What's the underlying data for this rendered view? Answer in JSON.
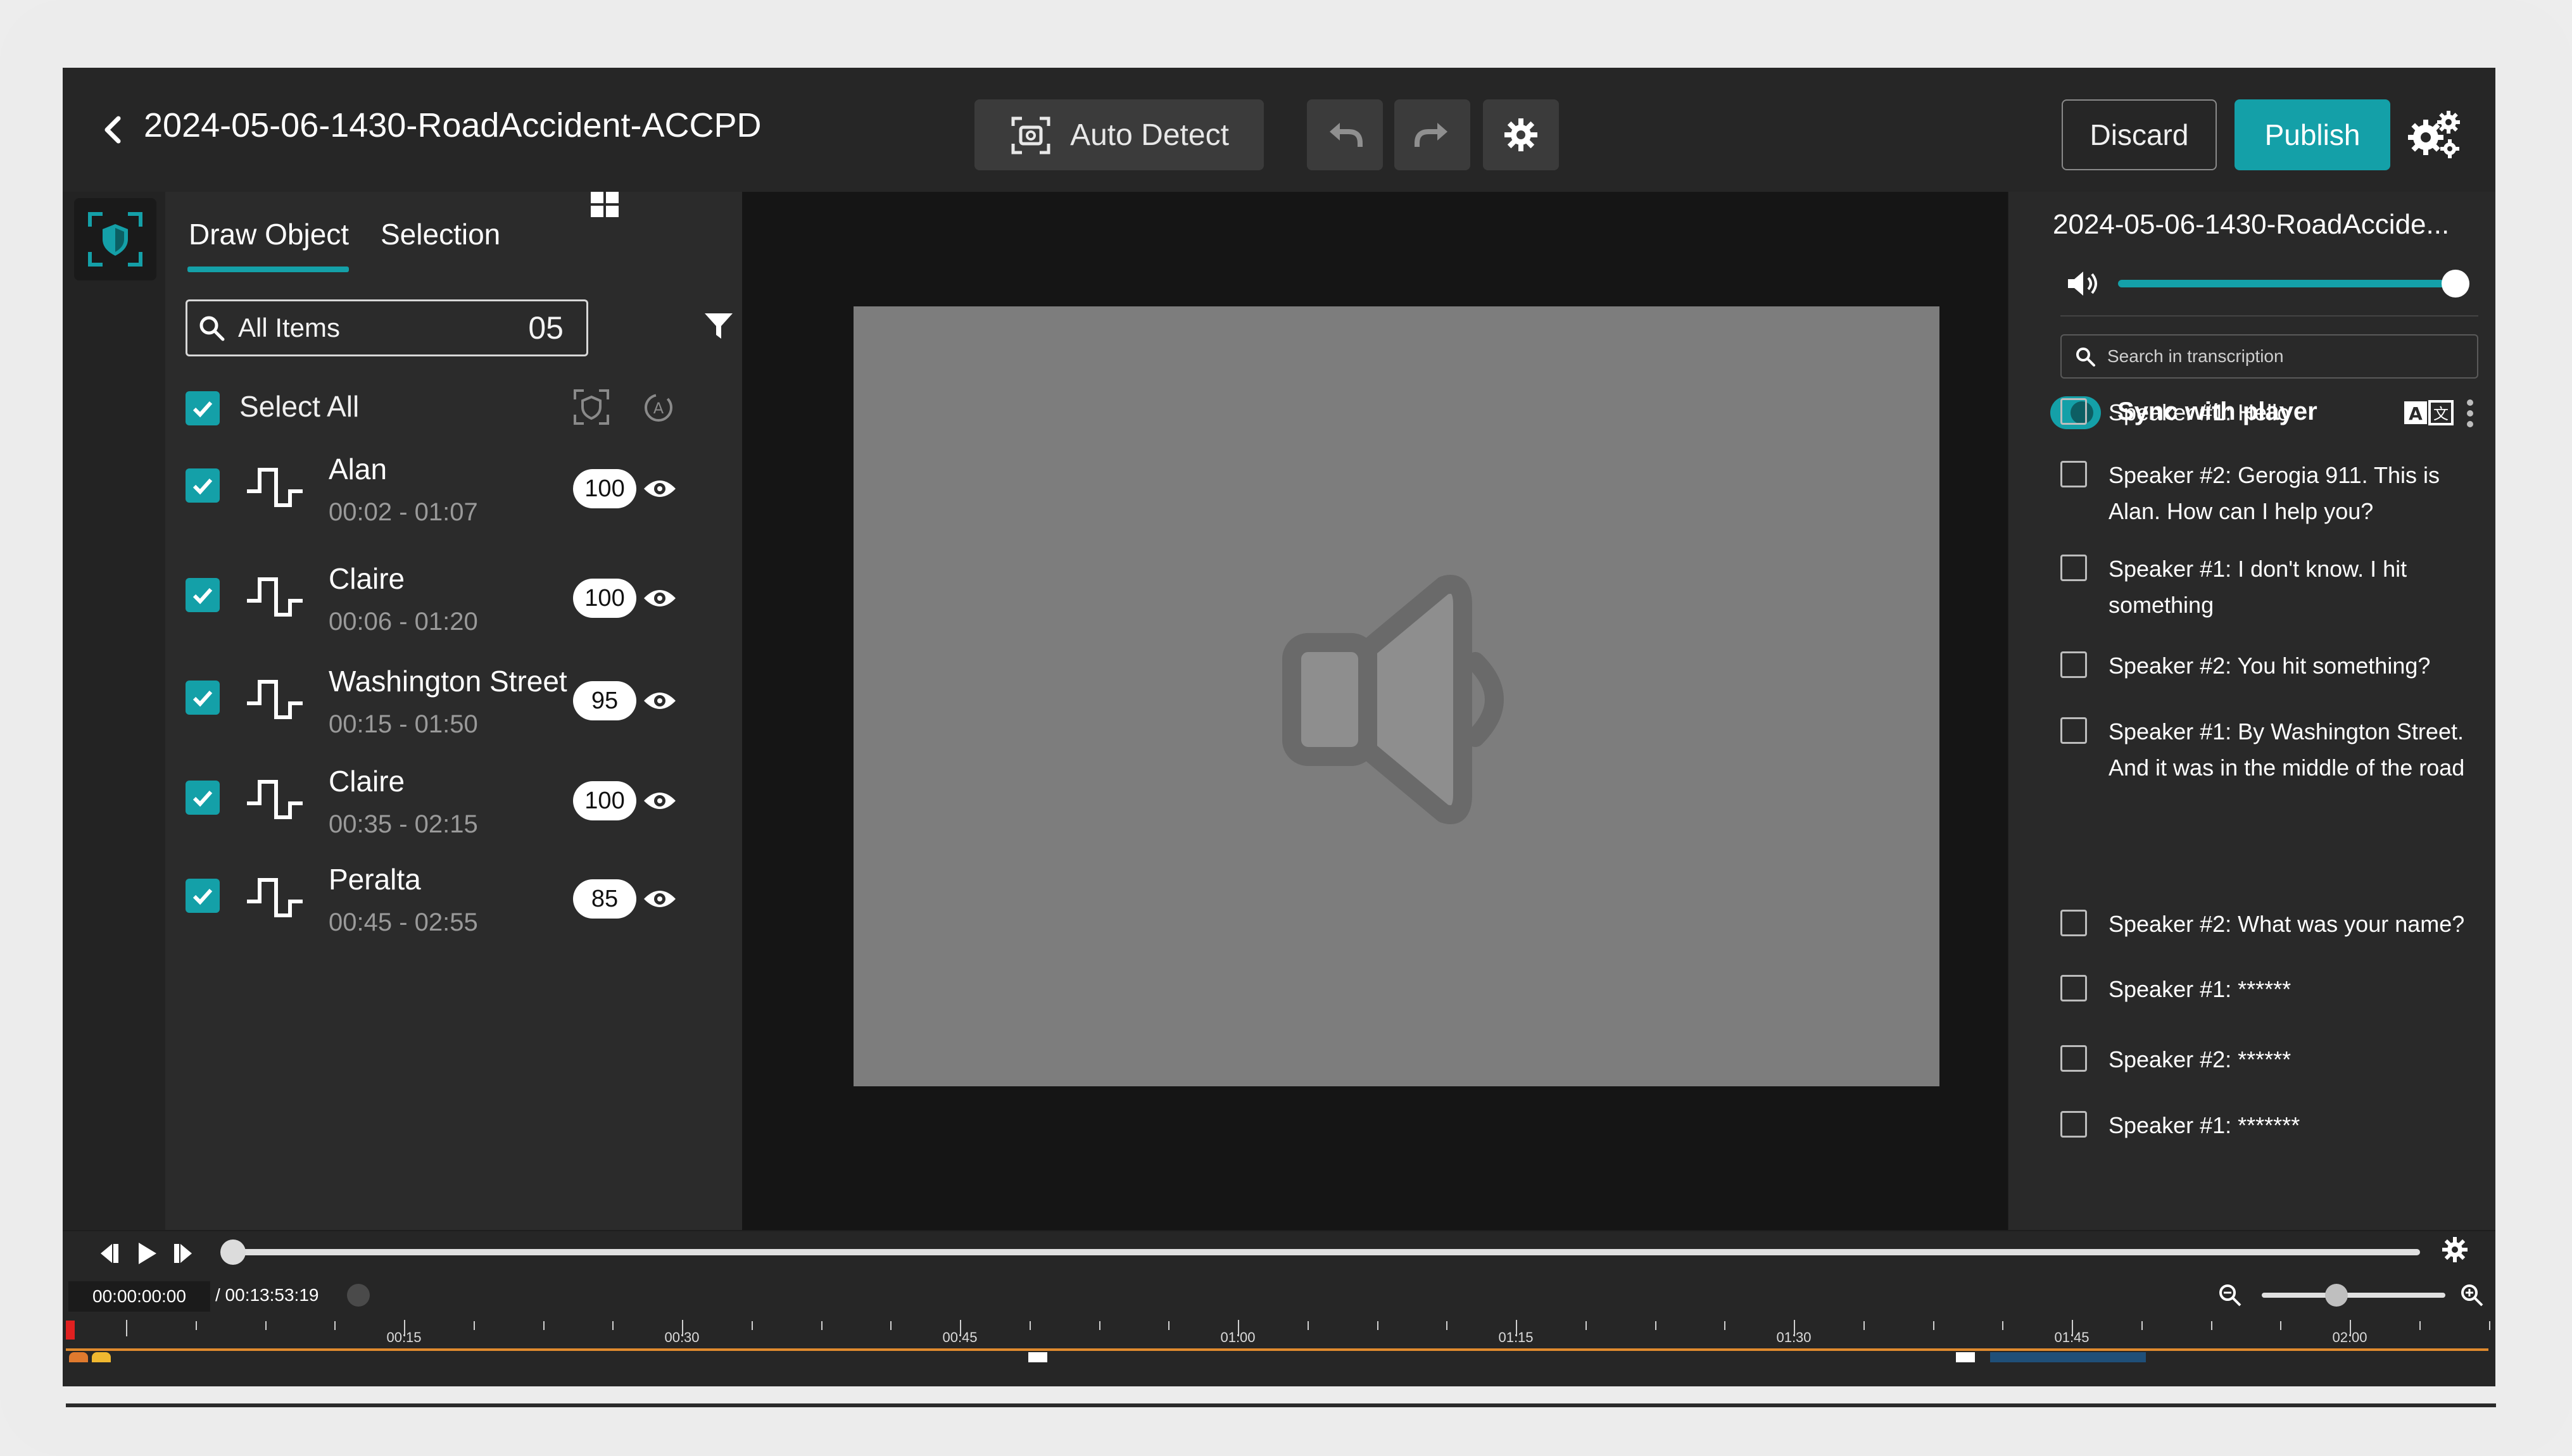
{
  "app": {
    "title": "2024-05-06-1430-RoadAccident-ACCPD"
  },
  "toolbar": {
    "auto_detect_label": "Auto Detect",
    "discard_label": "Discard",
    "publish_label": "Publish"
  },
  "left_panel": {
    "tabs": [
      {
        "label": "Draw Object",
        "active": true
      },
      {
        "label": "Selection",
        "active": false
      }
    ],
    "filter": {
      "label": "All Items",
      "count": "05"
    },
    "select_all_label": "Select All",
    "items": [
      {
        "name": "Alan",
        "time": "00:02 - 01:07",
        "score": "100",
        "checked": true
      },
      {
        "name": "Claire",
        "time": "00:06 - 01:20",
        "score": "100",
        "checked": true
      },
      {
        "name": "Washington Street",
        "time": "00:15 - 01:50",
        "score": "95",
        "checked": true
      },
      {
        "name": "Claire",
        "time": "00:35 - 02:15",
        "score": "100",
        "checked": true
      },
      {
        "name": "Peralta",
        "time": "00:45 - 02:55",
        "score": "85",
        "checked": true
      }
    ]
  },
  "transcript": {
    "title": "2024-05-06-1430-RoadAccide...",
    "volume": 1.0,
    "search_placeholder": "Search in transcription",
    "sync_label": "Sync with player",
    "sync_on": true,
    "lines": [
      "Speaker #1: Hello",
      "Speaker #2: Gerogia 911. This is Alan. How can I help you?",
      "Speaker #1: I don't know. I hit something",
      "Speaker #2: You hit something?",
      "Speaker #1: By Washington Street. And it was in the middle of the road",
      "Speaker #2: What was your name?",
      "Speaker #1: ******",
      "Speaker #2: ******",
      "Speaker #1: *******"
    ]
  },
  "player": {
    "current_time": "00:00:00:00",
    "total_time": "/ 00:13:53:19",
    "progress": 0.0,
    "zoom_level": 0.4,
    "ruler_labels": [
      "00:15",
      "00:30",
      "00:45",
      "01:00",
      "01:15",
      "01:30",
      "01:45",
      "02:00"
    ]
  },
  "colors": {
    "accent": "#14a0a8",
    "background": "#1e1e1e",
    "panel": "#2b2b2b",
    "media_placeholder": "#7d7d7d",
    "timeline": "#e08a2e",
    "playhead": "#e02020"
  },
  "icons": {
    "back": "chevron-left-icon",
    "auto_detect": "focus-camera-icon",
    "undo": "undo-icon",
    "redo": "redo-icon",
    "settings": "gear-icon",
    "global_settings": "gears-icon",
    "rail": "shield-scan-icon",
    "search": "search-icon",
    "grid": "grid-icon",
    "filter": "filter-icon",
    "waveform": "audio-wave-icon",
    "visibility": "eye-icon",
    "more": "kebab-icon",
    "media": "speaker-icon",
    "volume": "volume-icon",
    "translate": "translate-icon"
  }
}
